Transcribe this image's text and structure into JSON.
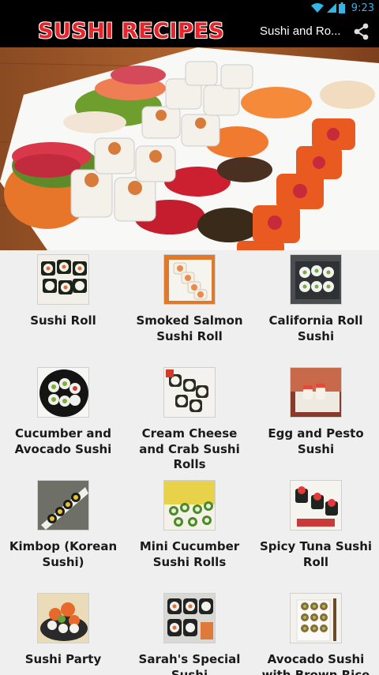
{
  "status_bar": {
    "time": "9:23",
    "icons": [
      "wifi-icon",
      "signal-icon",
      "battery-icon"
    ],
    "accent_color": "#33b5e5"
  },
  "action_bar": {
    "title": "SUSHI RECIPES",
    "subtitle": "Sushi and Ro...",
    "share_icon": "share-icon",
    "title_color": "#e8242a"
  },
  "recipes": [
    {
      "label": "Sushi Roll",
      "thumb": "sushi-roll"
    },
    {
      "label": "Smoked Salmon Sushi Roll",
      "thumb": "smoked-salmon"
    },
    {
      "label": "California Roll Sushi",
      "thumb": "california-roll"
    },
    {
      "label": "Cucumber and Avocado Sushi",
      "thumb": "cucumber-avocado"
    },
    {
      "label": "Cream Cheese and Crab Sushi Rolls",
      "thumb": "cream-cheese-crab"
    },
    {
      "label": "Egg and Pesto Sushi",
      "thumb": "egg-pesto"
    },
    {
      "label": "Kimbop (Korean Sushi)",
      "thumb": "kimbop"
    },
    {
      "label": "Mini Cucumber Sushi Rolls",
      "thumb": "mini-cucumber"
    },
    {
      "label": "Spicy Tuna Sushi Roll",
      "thumb": "spicy-tuna"
    },
    {
      "label": "Sushi Party",
      "thumb": "sushi-party"
    },
    {
      "label": "Sarah's Special Sushi",
      "thumb": "sarahs-special"
    },
    {
      "label": "Avocado Sushi with Brown Rice",
      "thumb": "avocado-brown-rice"
    }
  ]
}
